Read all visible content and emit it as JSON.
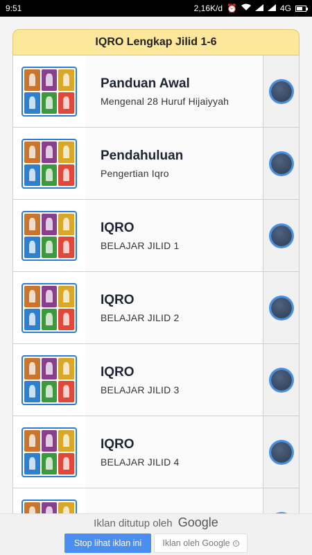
{
  "statusbar": {
    "time": "9:51",
    "speed": "2,16K/d",
    "network": "4G"
  },
  "header": {
    "title": "IQRO Lengkap Jilid 1-6"
  },
  "list": [
    {
      "title": "Panduan Awal",
      "subtitle": "Mengenal 28 Huruf Hijaiyyah"
    },
    {
      "title": "Pendahuluan",
      "subtitle": "Pengertian Iqro"
    },
    {
      "title": "IQRO",
      "subtitle": "BELAJAR JILID 1"
    },
    {
      "title": "IQRO",
      "subtitle": "BELAJAR JILID 2"
    },
    {
      "title": "IQRO",
      "subtitle": "BELAJAR JILID 3"
    },
    {
      "title": "IQRO",
      "subtitle": "BELAJAR JILID 4"
    },
    {
      "title": "",
      "subtitle": ""
    }
  ],
  "ad": {
    "closed_text": "Iklan ditutup oleh",
    "google": "Google",
    "stop_button": "Stop lihat iklan ini",
    "ads_by": "Iklan oleh Google"
  },
  "colors": {
    "accent": "#4a8ef0",
    "title_bg": "#fce79a",
    "dot": "#2b3b52"
  }
}
